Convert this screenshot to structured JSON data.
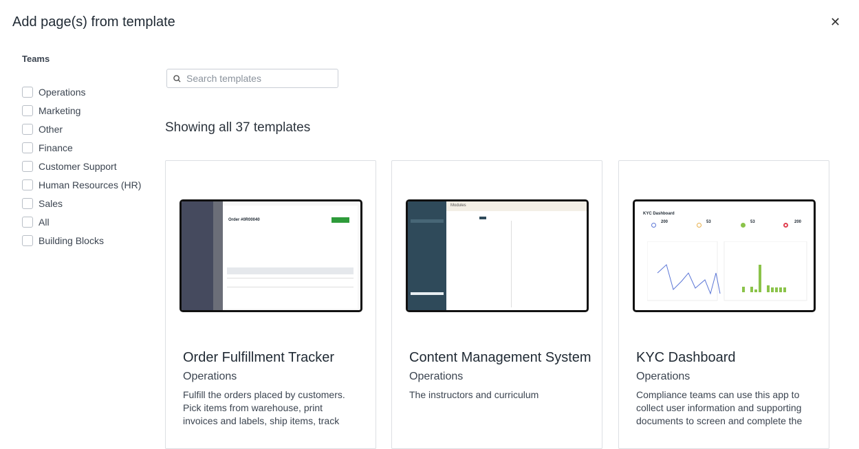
{
  "dialog": {
    "title": "Add page(s) from template",
    "close_icon": "close-icon"
  },
  "filters": {
    "heading": "Teams",
    "items": [
      "Operations",
      "Marketing",
      "Other",
      "Finance",
      "Customer Support",
      "Human Resources (HR)",
      "Sales",
      "All",
      "Building Blocks"
    ]
  },
  "search": {
    "placeholder": "Search templates",
    "value": ""
  },
  "results": {
    "summary": "Showing all 37 templates"
  },
  "templates": [
    {
      "title": "Order Fulfillment Tracker",
      "team": "Operations",
      "description": "Fulfill the orders placed by customers. Pick items from warehouse, print invoices and labels, ship items, track",
      "preview_heading": "Order #0R00040"
    },
    {
      "title": "Content Management System",
      "team": "Operations",
      "description": "The instructors and curriculum",
      "preview_heading": "Modules"
    },
    {
      "title": "KYC Dashboard",
      "team": "Operations",
      "description": "Compliance teams can use this app to collect user information and supporting documents to screen and complete the",
      "preview_heading": "KYC Dashboard",
      "preview_stats": [
        "200",
        "53",
        "53",
        "200"
      ]
    }
  ],
  "colors": {
    "sidebar_dark": "#454a5e",
    "cms_sidebar": "#2f4a5a",
    "success_green": "#2e9b3a",
    "chart_blue": "#5b76d6",
    "chart_green": "#8bc34a"
  }
}
